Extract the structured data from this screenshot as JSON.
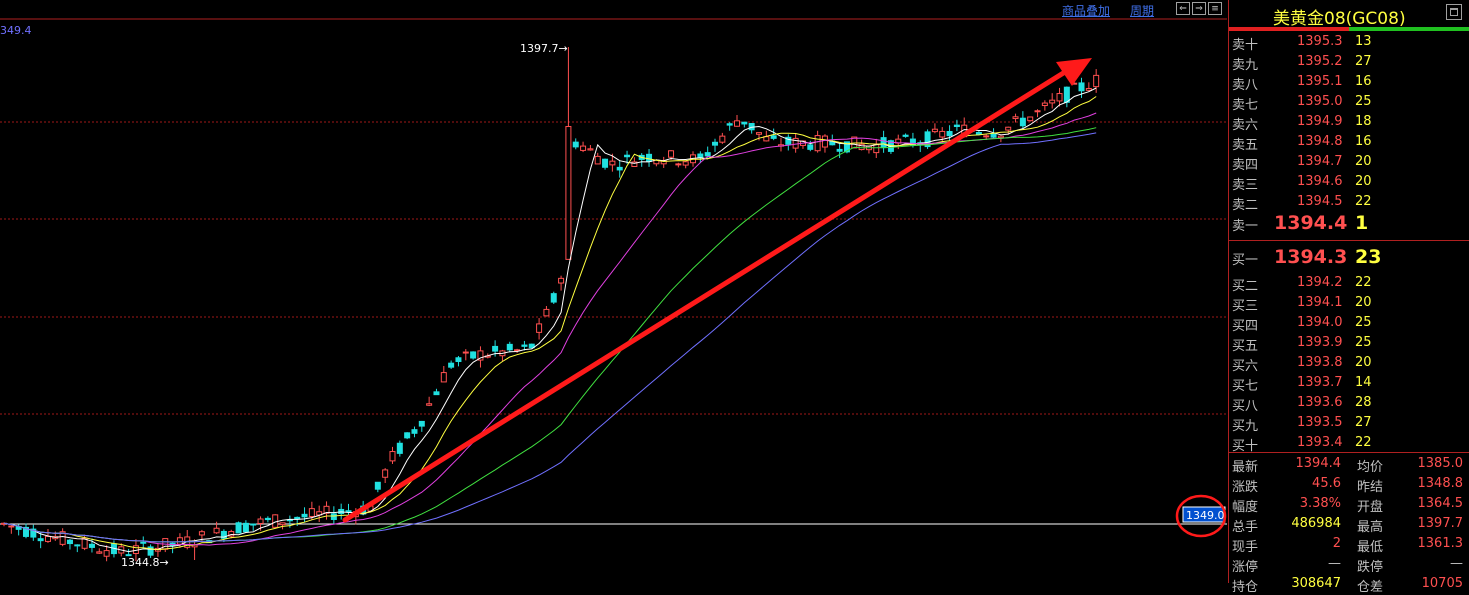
{
  "toolbar": {
    "overlay_label": "商品叠加",
    "period_label": "周期",
    "btn_prev": "⇐",
    "btn_next": "⇒",
    "btn_menu": "≡"
  },
  "axis": {
    "top_value": "349.4",
    "ref_price": "1349.0"
  },
  "chart_annotations": {
    "high_label": "1397.7→",
    "low_label": "1344.8→"
  },
  "quote": {
    "title": "美黄金08(GC08)",
    "asks": [
      {
        "label": "卖十",
        "price": "1395.3",
        "vol": "13"
      },
      {
        "label": "卖九",
        "price": "1395.2",
        "vol": "27"
      },
      {
        "label": "卖八",
        "price": "1395.1",
        "vol": "16"
      },
      {
        "label": "卖七",
        "price": "1395.0",
        "vol": "25"
      },
      {
        "label": "卖六",
        "price": "1394.9",
        "vol": "18"
      },
      {
        "label": "卖五",
        "price": "1394.8",
        "vol": "16"
      },
      {
        "label": "卖四",
        "price": "1394.7",
        "vol": "20"
      },
      {
        "label": "卖三",
        "price": "1394.6",
        "vol": "20"
      },
      {
        "label": "卖二",
        "price": "1394.5",
        "vol": "22"
      },
      {
        "label": "卖一",
        "price": "1394.4",
        "vol": "1"
      }
    ],
    "bids": [
      {
        "label": "买一",
        "price": "1394.3",
        "vol": "23"
      },
      {
        "label": "买二",
        "price": "1394.2",
        "vol": "22"
      },
      {
        "label": "买三",
        "price": "1394.1",
        "vol": "20"
      },
      {
        "label": "买四",
        "price": "1394.0",
        "vol": "25"
      },
      {
        "label": "买五",
        "price": "1393.9",
        "vol": "25"
      },
      {
        "label": "买六",
        "price": "1393.8",
        "vol": "20"
      },
      {
        "label": "买七",
        "price": "1393.7",
        "vol": "14"
      },
      {
        "label": "买八",
        "price": "1393.6",
        "vol": "28"
      },
      {
        "label": "买九",
        "price": "1393.5",
        "vol": "27"
      },
      {
        "label": "买十",
        "price": "1393.4",
        "vol": "22"
      }
    ],
    "stats": [
      {
        "l1": "最新",
        "v1": "1394.4",
        "l2": "均价",
        "v2": "1385.0"
      },
      {
        "l1": "涨跌",
        "v1": "45.6",
        "l2": "昨结",
        "v2": "1348.8"
      },
      {
        "l1": "幅度",
        "v1": "3.38%",
        "l2": "开盘",
        "v2": "1364.5"
      },
      {
        "l1": "总手",
        "v1": "486984",
        "l2": "最高",
        "v2": "1397.7"
      },
      {
        "l1": "现手",
        "v1": "2",
        "l2": "最低",
        "v2": "1361.3"
      },
      {
        "l1": "涨停",
        "v1": "—",
        "l2": "跌停",
        "v2": "—"
      },
      {
        "l1": "持仓",
        "v1": "308647",
        "l2": "仓差",
        "v2": "10705"
      }
    ]
  },
  "colors": {
    "up": "#ff5050",
    "down": "#20e0e0",
    "arrow": "#ff1a1a",
    "ma5": "#ffffff",
    "ma10": "#ffff40",
    "ma20": "#e040e0",
    "ma40": "#40e040",
    "ma60": "#7070ff"
  }
}
